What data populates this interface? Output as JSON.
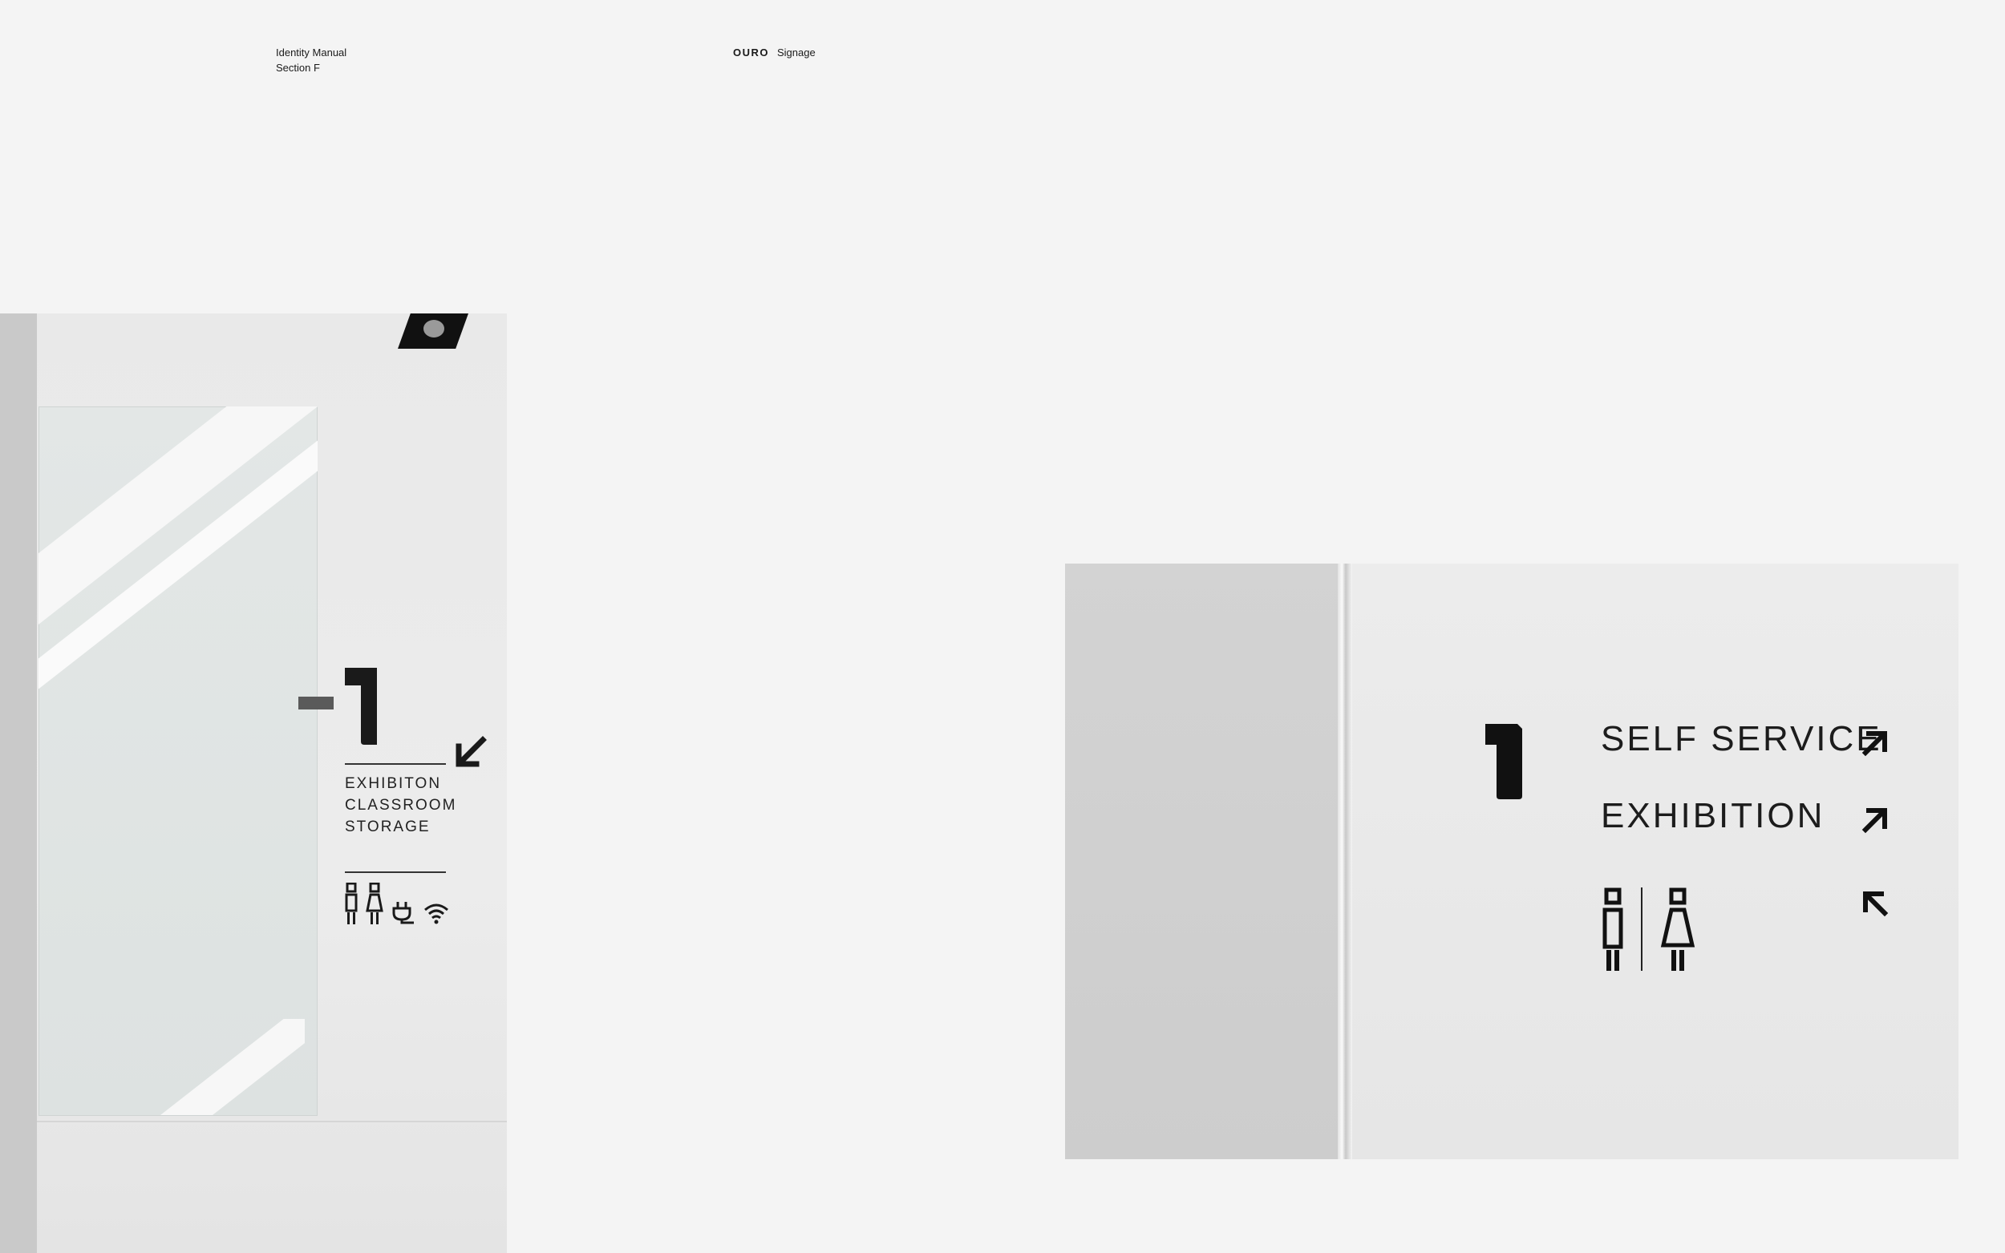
{
  "header": {
    "manual_title": "Identity Manual",
    "section": "Section F",
    "brand": "OURO",
    "topic": "Signage"
  },
  "left_sign": {
    "level": "-1",
    "destinations": [
      "EXHIBITON",
      "CLASSROOM",
      "STORAGE"
    ],
    "icons": [
      "male-toilet-icon",
      "female-toilet-icon",
      "power-plug-icon",
      "wifi-icon"
    ],
    "arrow": "arrow-down-left-icon"
  },
  "right_sign": {
    "level": "1",
    "rows": [
      {
        "label": "SELF SERVICE",
        "arrow": "arrow-up-right-icon"
      },
      {
        "label": "EXHIBITION",
        "arrow": "arrow-up-right-icon"
      }
    ],
    "toilet_icons": [
      "male-toilet-icon",
      "female-toilet-icon"
    ],
    "toilet_arrow": "arrow-up-left-icon"
  }
}
